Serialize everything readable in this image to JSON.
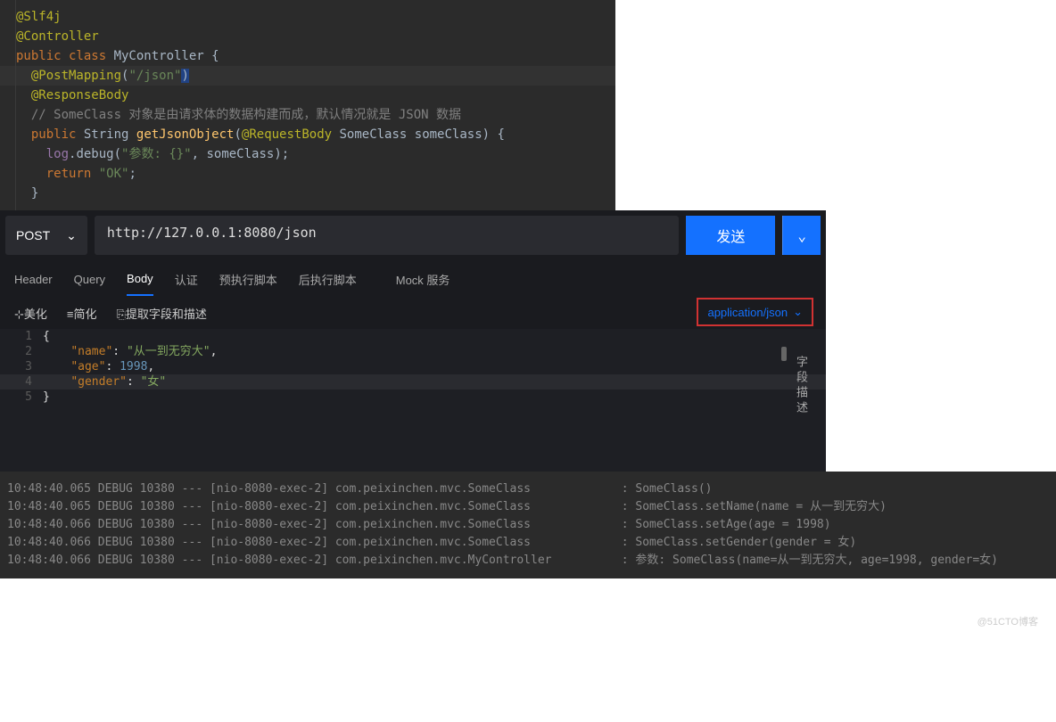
{
  "code": {
    "lines": [
      {
        "indent": 0,
        "tokens": [
          {
            "t": "@Slf4j",
            "c": "annotation"
          }
        ]
      },
      {
        "indent": 0,
        "tokens": [
          {
            "t": "@Controller",
            "c": "annotation"
          }
        ]
      },
      {
        "indent": 0,
        "tokens": [
          {
            "t": "public class ",
            "c": "keyword"
          },
          {
            "t": "MyController {",
            "c": "classname"
          }
        ]
      },
      {
        "indent": 1,
        "tokens": [
          {
            "t": "@PostMapping",
            "c": "annotation"
          },
          {
            "t": "(",
            "c": ""
          },
          {
            "t": "\"/json\"",
            "c": "string"
          },
          {
            "t": ")",
            "c": "",
            "hl": true
          }
        ]
      },
      {
        "indent": 1,
        "tokens": [
          {
            "t": "@ResponseBody",
            "c": "annotation"
          }
        ]
      },
      {
        "indent": 1,
        "tokens": [
          {
            "t": "// SomeClass 对象是由请求体的数据构建而成，默认情况就是 JSON 数据",
            "c": "comment"
          }
        ]
      },
      {
        "indent": 1,
        "tokens": [
          {
            "t": "public ",
            "c": "keyword"
          },
          {
            "t": "String ",
            "c": ""
          },
          {
            "t": "getJsonObject",
            "c": "method"
          },
          {
            "t": "(",
            "c": ""
          },
          {
            "t": "@RequestBody ",
            "c": "param-anno"
          },
          {
            "t": "SomeClass someClass) {",
            "c": ""
          }
        ]
      },
      {
        "indent": 2,
        "tokens": [
          {
            "t": "log",
            "c": "field"
          },
          {
            "t": ".debug(",
            "c": ""
          },
          {
            "t": "\"参数: {}\"",
            "c": "string"
          },
          {
            "t": ", someClass);",
            "c": ""
          }
        ]
      },
      {
        "indent": 0,
        "tokens": [
          {
            "t": "",
            "c": ""
          }
        ]
      },
      {
        "indent": 2,
        "tokens": [
          {
            "t": "return ",
            "c": "keyword"
          },
          {
            "t": "\"OK\"",
            "c": "string"
          },
          {
            "t": ";",
            "c": ""
          }
        ]
      },
      {
        "indent": 1,
        "tokens": [
          {
            "t": "}",
            "c": ""
          }
        ]
      }
    ]
  },
  "api": {
    "method": "POST",
    "url": "http://127.0.0.1:8080/json",
    "send_label": "发送",
    "tabs": [
      "Header",
      "Query",
      "Body",
      "认证",
      "预执行脚本",
      "后执行脚本"
    ],
    "mock_label": "Mock 服务",
    "active_tab": 2,
    "toolbar": [
      "⊹美化",
      "≡简化",
      "⎘提取字段和描述"
    ],
    "content_type": "application/json",
    "side_label": "字段描述",
    "json_lines": [
      {
        "n": 1,
        "text": "{"
      },
      {
        "n": 2,
        "key": "name",
        "val": "从一到无穷大",
        "type": "str",
        "comma": true
      },
      {
        "n": 3,
        "key": "age",
        "val": "1998",
        "type": "num",
        "comma": true
      },
      {
        "n": 4,
        "key": "gender",
        "val": "女",
        "type": "str",
        "comma": false,
        "current": true
      },
      {
        "n": 5,
        "text": "}"
      }
    ]
  },
  "console": {
    "lines": [
      "10:48:40.065 DEBUG 10380 --- [nio-8080-exec-2] com.peixinchen.mvc.SomeClass             : SomeClass()",
      "10:48:40.065 DEBUG 10380 --- [nio-8080-exec-2] com.peixinchen.mvc.SomeClass             : SomeClass.setName(name = 从一到无穷大)",
      "10:48:40.066 DEBUG 10380 --- [nio-8080-exec-2] com.peixinchen.mvc.SomeClass             : SomeClass.setAge(age = 1998)",
      "10:48:40.066 DEBUG 10380 --- [nio-8080-exec-2] com.peixinchen.mvc.SomeClass             : SomeClass.setGender(gender = 女)",
      "10:48:40.066 DEBUG 10380 --- [nio-8080-exec-2] com.peixinchen.mvc.MyController          : 参数: SomeClass(name=从一到无穷大, age=1998, gender=女)"
    ]
  },
  "watermark": "@51CTO博客"
}
